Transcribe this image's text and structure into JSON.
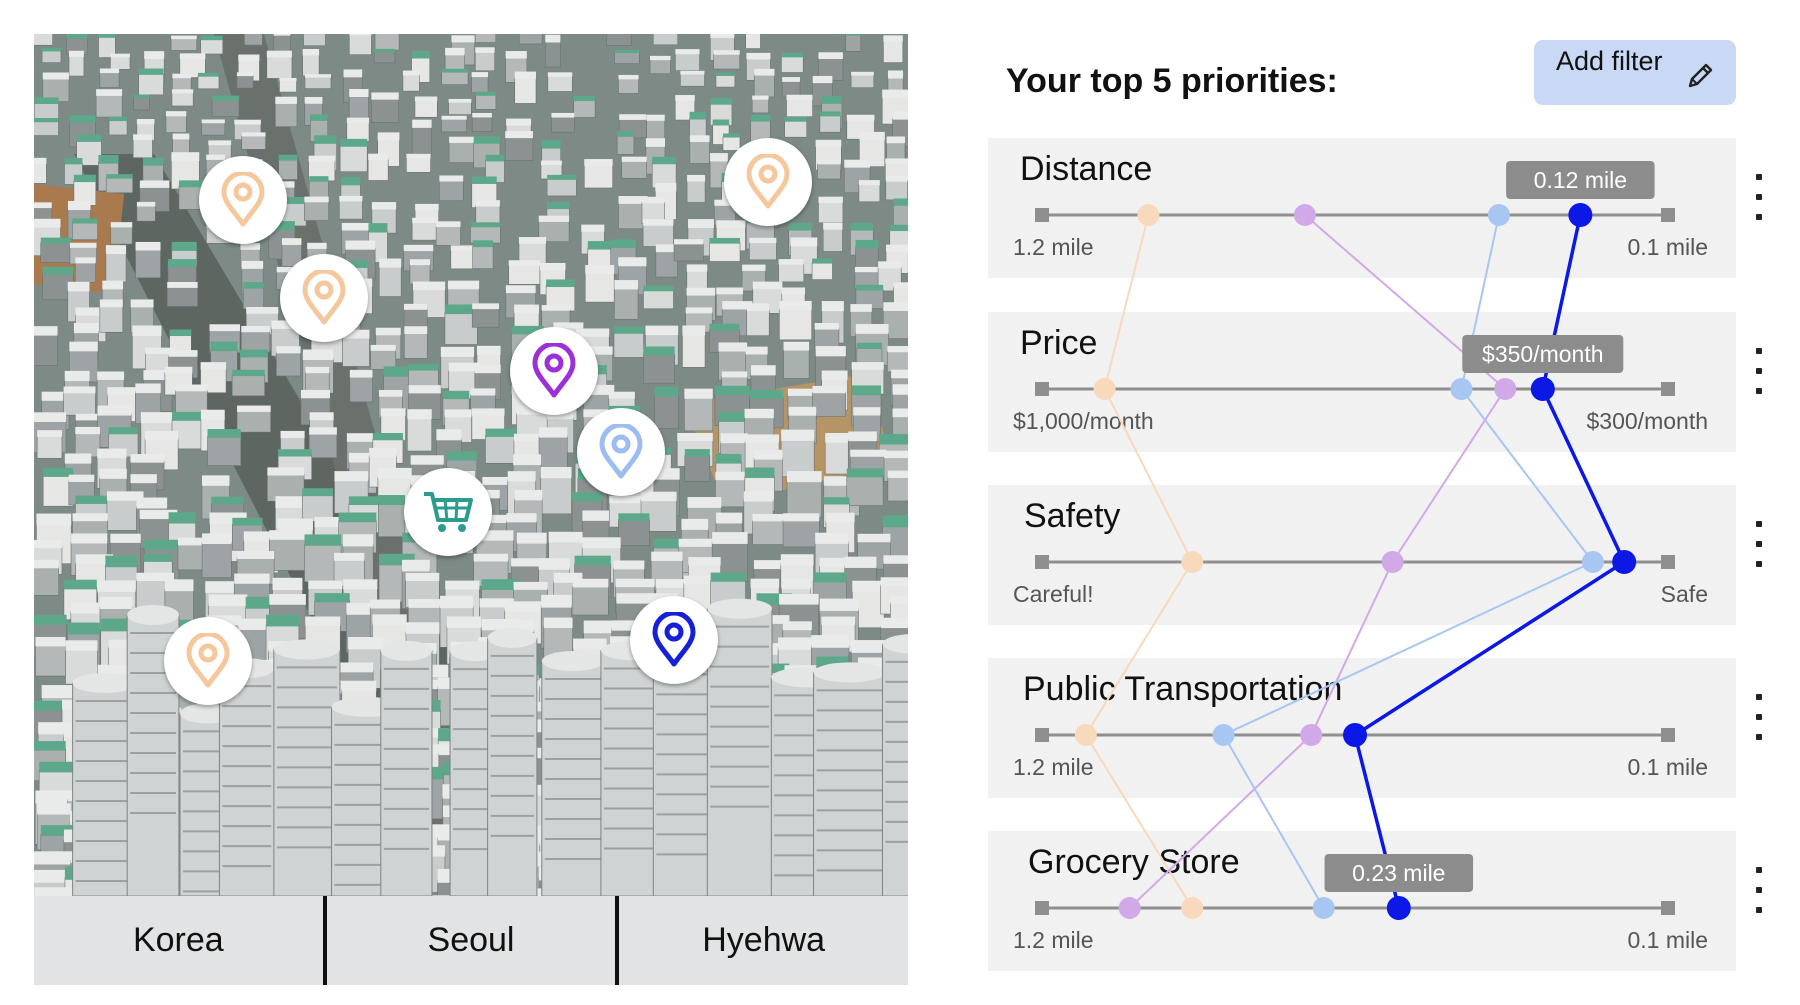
{
  "map": {
    "pins": [
      {
        "icon": "map-pin-icon",
        "color": "#f5c79c"
      },
      {
        "icon": "map-pin-icon",
        "color": "#f5c79c"
      },
      {
        "icon": "map-pin-icon",
        "color": "#f5c79c"
      },
      {
        "icon": "map-pin-icon",
        "color": "#f5c79c"
      },
      {
        "icon": "map-pin-icon",
        "color": "#9b30d9"
      },
      {
        "icon": "map-pin-icon",
        "color": "#9dbdf0"
      },
      {
        "icon": "shopping-cart-icon",
        "color": "#2a9d8f"
      },
      {
        "icon": "map-pin-icon",
        "color": "#1620d8"
      }
    ],
    "breadcrumb": [
      "Korea",
      "Seoul",
      "Hyehwa"
    ]
  },
  "panel": {
    "title": "Your top 5 priorities:",
    "add_filter_label": "Add filter",
    "add_filter_icon": "pencil-icon",
    "menu_icon": "more-vertical-icon"
  },
  "chart_data": {
    "type": "parallel-coordinates",
    "axes": [
      {
        "name": "Distance",
        "min_label": "1.2 mile",
        "max_label": "0.1 mile"
      },
      {
        "name": "Price",
        "min_label": "$1,000/month",
        "max_label": "$300/month"
      },
      {
        "name": "Safety",
        "min_label": "Careful!",
        "max_label": "Safe"
      },
      {
        "name": "Public Transportation",
        "min_label": "1.2 mile",
        "max_label": "0.1 mile"
      },
      {
        "name": "Grocery Store",
        "min_label": "1.2 mile",
        "max_label": "0.1 mile"
      }
    ],
    "series": [
      {
        "color": "#f9d9bb",
        "values": [
          0.17,
          0.1,
          0.24,
          0.07,
          0.24
        ]
      },
      {
        "color": "#d1a9e8",
        "values": [
          0.42,
          0.74,
          0.56,
          0.43,
          0.14
        ]
      },
      {
        "color": "#a8c6f2",
        "values": [
          0.73,
          0.67,
          0.88,
          0.29,
          0.45
        ]
      },
      {
        "color": "#0b18e6",
        "values": [
          0.86,
          0.8,
          0.93,
          0.5,
          0.57
        ],
        "highlighted": true
      }
    ],
    "tooltips": [
      {
        "axis": 0,
        "text": "0.12 mile"
      },
      {
        "axis": 1,
        "text": "$350/month"
      },
      {
        "axis": 4,
        "text": "0.23 mile"
      }
    ]
  }
}
